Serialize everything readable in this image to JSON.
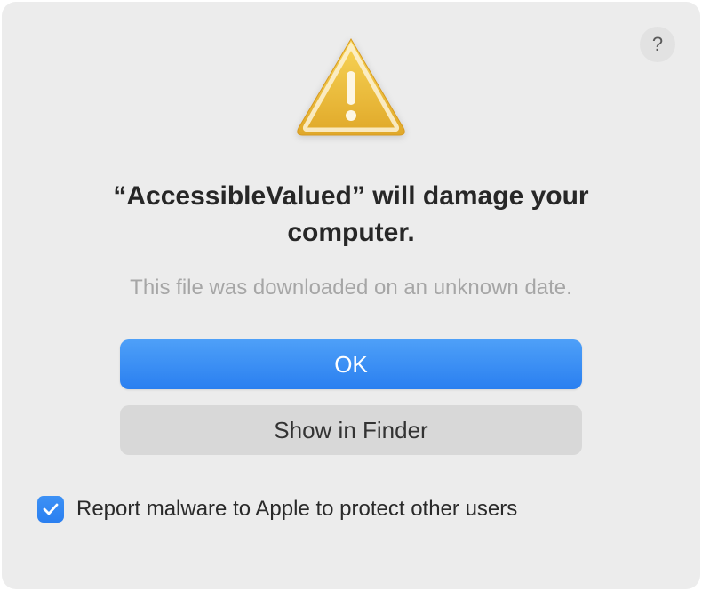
{
  "dialog": {
    "help_label": "?",
    "title": "“AccessibleValued” will damage your computer.",
    "subtitle": "This file was downloaded on an unknown date.",
    "primary_button": "OK",
    "secondary_button": "Show in Finder",
    "checkbox_label": "Report malware to Apple to protect other users",
    "checkbox_checked": true
  }
}
